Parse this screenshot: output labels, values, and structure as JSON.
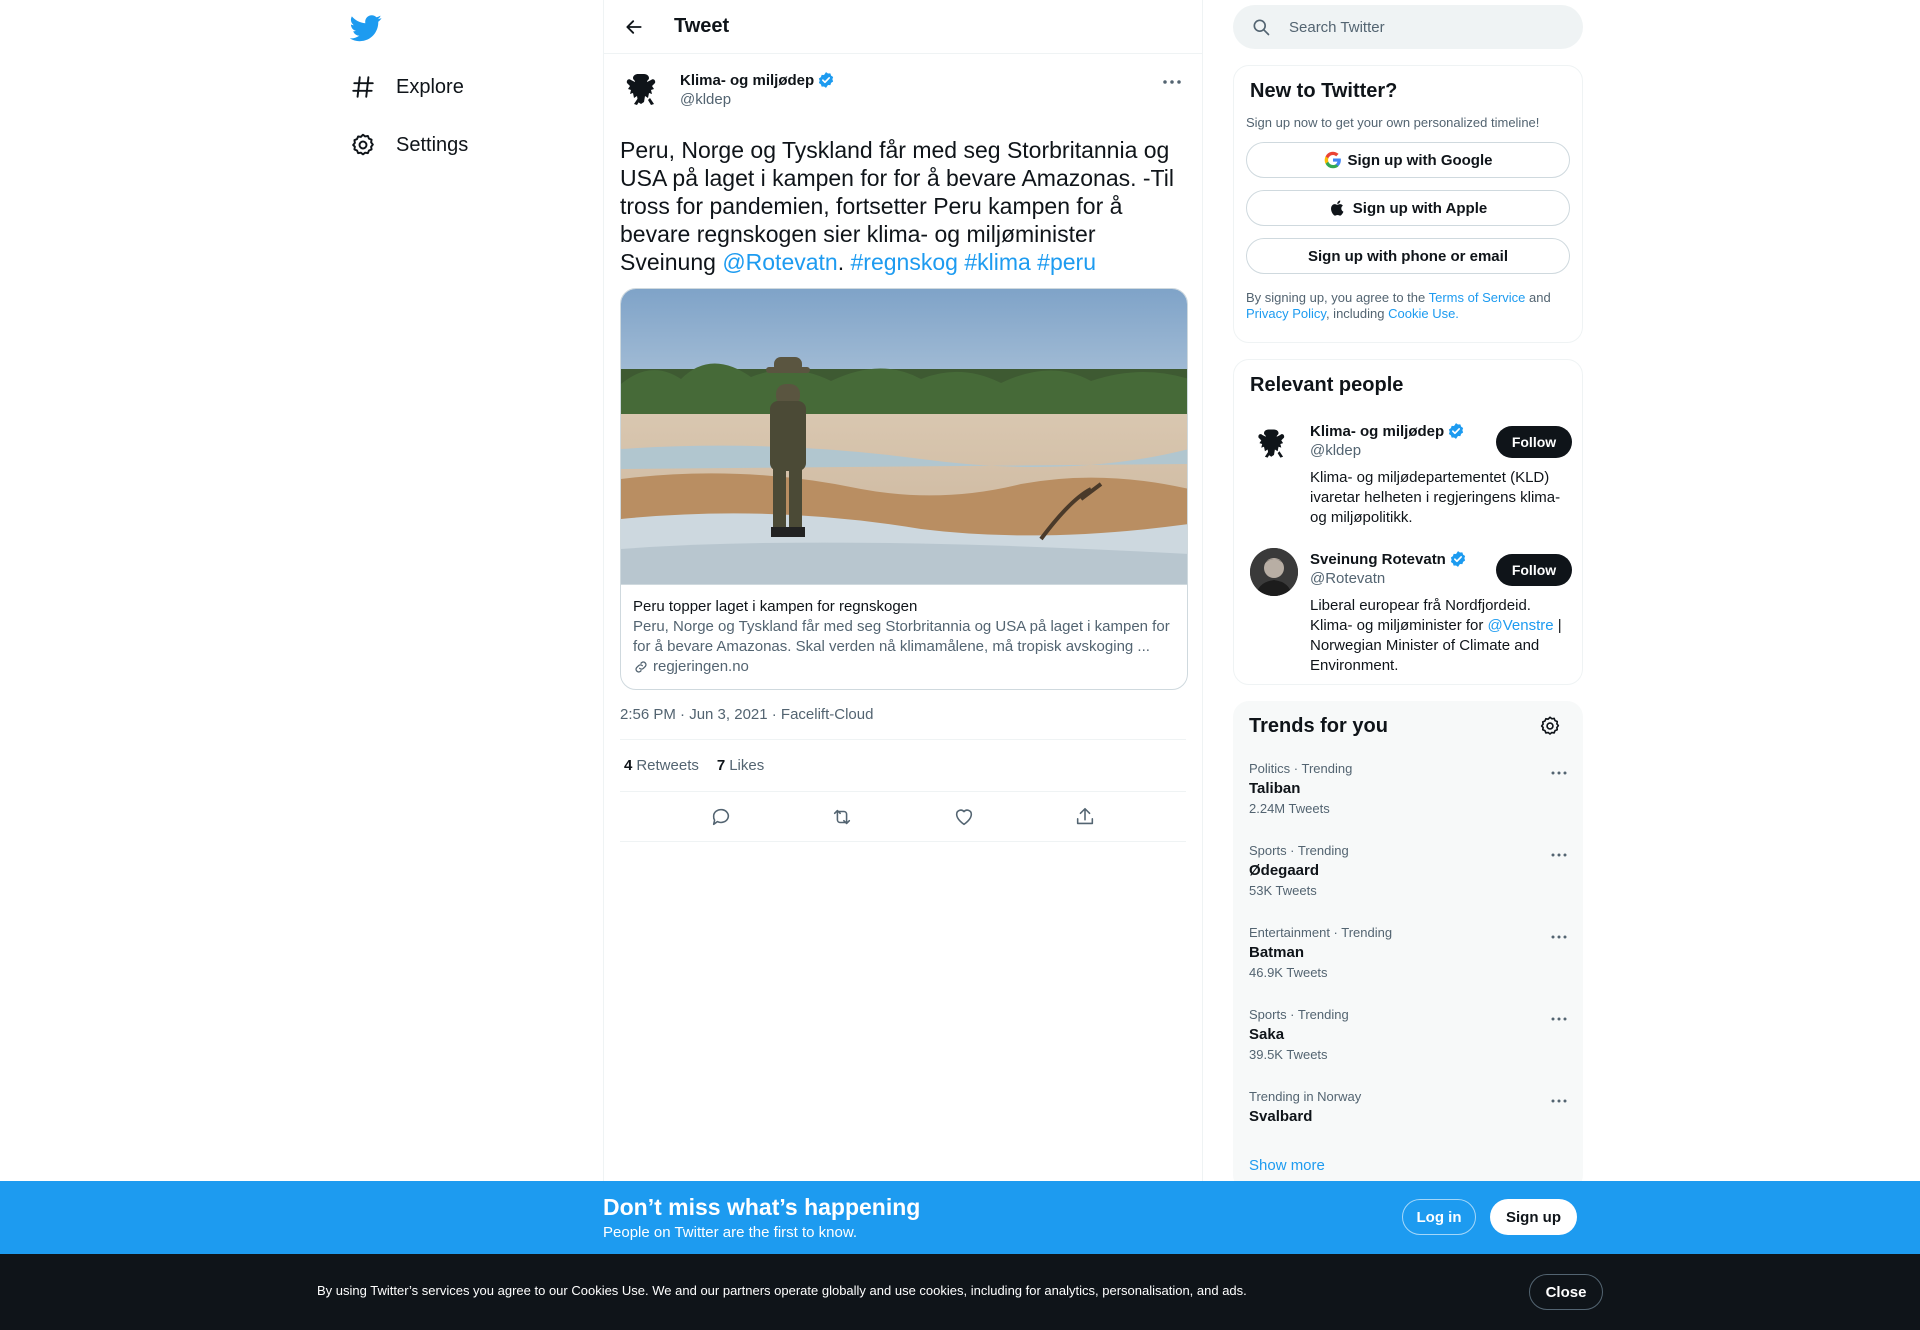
{
  "nav": {
    "logo_icon": "twitter-bird-icon",
    "items": [
      {
        "label": "Explore",
        "icon": "hashtag-icon"
      },
      {
        "label": "Settings",
        "icon": "gear-icon"
      }
    ]
  },
  "main": {
    "title": "Tweet",
    "tweet": {
      "author_name": "Klima- og miljødep",
      "author_handle": "@kldep",
      "text_parts": [
        "Peru, Norge og Tyskland får med seg Storbritannia og USA på laget i kampen for for å bevare Amazonas.  -Til tross for pandemien, fortsetter Peru kampen for å bevare regnskogen sier klima- og miljøminister Sveinung ",
        "@Rotevatn",
        ".  ",
        "#regnskog",
        " ",
        "#klima",
        " ",
        "#peru"
      ],
      "card": {
        "title": "Peru topper laget i kampen for regnskogen",
        "description": "Peru, Norge og Tyskland får med seg Storbritannia og USA på laget i kampen for for å bevare Amazonas. Skal verden nå klimamålene, må tropisk avskoging ...",
        "domain": "regjeringen.no"
      },
      "timestamp": "2:56 PM · Jun 3, 2021 · Facelift-Cloud",
      "retweets_count": "4",
      "retweets_label": "Retweets",
      "likes_count": "7",
      "likes_label": "Likes"
    }
  },
  "sidebar": {
    "search_placeholder": "Search Twitter",
    "new_to_twitter": {
      "title": "New to Twitter?",
      "subtitle": "Sign up now to get your own personalized timeline!",
      "google_label": "Sign up with Google",
      "apple_label": "Sign up with Apple",
      "phone_label": "Sign up with phone or email",
      "legal_1": "By signing up, you agree to the ",
      "terms": "Terms of Service",
      "legal_2": " and ",
      "privacy": "Privacy Policy",
      "legal_3": ", including ",
      "cookie": "Cookie Use."
    },
    "relevant_people": {
      "title": "Relevant people",
      "people": [
        {
          "name": "Klima- og miljødep",
          "handle": "@kldep",
          "bio": "Klima- og miljødepartementet (KLD) ivaretar helheten i regjeringens klima- og miljøpolitikk.",
          "follow_label": "Follow"
        },
        {
          "name": "Sveinung Rotevatn",
          "handle": "@Rotevatn",
          "bio_1": "Liberal europear frå Nordfjordeid. Klima- og miljøminister for ",
          "bio_link": "@Venstre",
          "bio_2": " | Norwegian Minister of Climate and Environment.",
          "follow_label": "Follow"
        }
      ]
    },
    "trends": {
      "title": "Trends for you",
      "items": [
        {
          "context": "Politics · Trending",
          "name": "Taliban",
          "count": "2.24M Tweets"
        },
        {
          "context": "Sports · Trending",
          "name": "Ødegaard",
          "count": "53K Tweets"
        },
        {
          "context": "Entertainment · Trending",
          "name": "Batman",
          "count": "46.9K Tweets"
        },
        {
          "context": "Sports · Trending",
          "name": "Saka",
          "count": "39.5K Tweets"
        },
        {
          "context": "Trending in Norway",
          "name": "Svalbard",
          "count": ""
        }
      ],
      "show_more": "Show more"
    }
  },
  "banner": {
    "title": "Don’t miss what’s happening",
    "subtitle": "People on Twitter are the first to know.",
    "login_label": "Log in",
    "signup_label": "Sign up"
  },
  "cookie_bar": {
    "text": "By using Twitter’s services you agree to our Cookies Use. We and our partners operate globally and use cookies, including for analytics, personalisation, and ads.",
    "close_label": "Close"
  },
  "colors": {
    "accent": "#1d9bf0",
    "text": "#0f1419",
    "muted": "#536471",
    "dark_bar": "#0f1419"
  }
}
